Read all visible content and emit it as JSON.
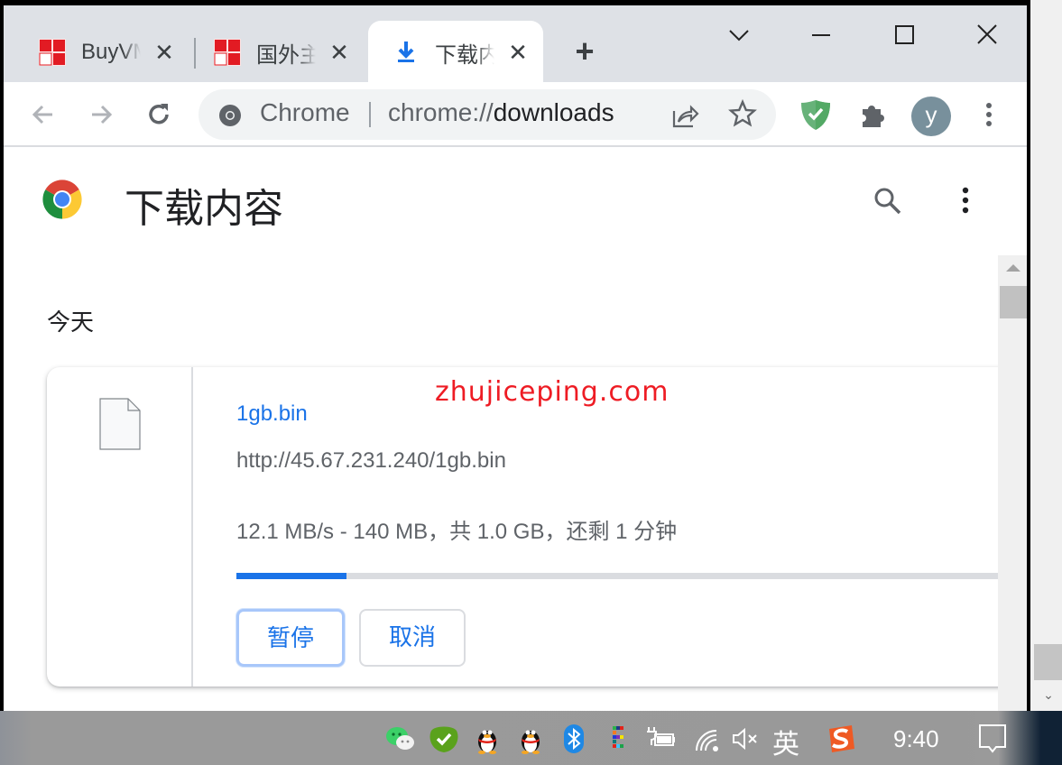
{
  "tabs": [
    {
      "label": "BuyVM",
      "favicon": "site-red-favicon",
      "close": "close-icon"
    },
    {
      "label": "国外主",
      "favicon": "site-red-favicon",
      "close": "close-icon"
    },
    {
      "label": "下载内容",
      "favicon": "download-icon",
      "close": "close-icon",
      "active": true
    }
  ],
  "window_controls": {
    "tab_search": "chevron-down-icon",
    "minimize": "minimize-icon",
    "maximize": "maximize-icon",
    "close": "close-icon"
  },
  "toolbar": {
    "omnibox_chip": "Chrome",
    "url_scheme": "chrome://",
    "url_host": "downloads",
    "avatar_letter": "y"
  },
  "page": {
    "title": "下载内容",
    "section": "今天",
    "watermark": "zhujiceping.com",
    "download": {
      "file_name": "1gb.bin",
      "url": "http://45.67.231.240/1gb.bin",
      "status": "12.1 MB/s - 140 MB，共 1.0 GB，还剩 1 分钟",
      "progress": 0.14,
      "pause_label": "暂停",
      "cancel_label": "取消"
    }
  },
  "taskbar": {
    "ime": "英",
    "clock": "9:40"
  },
  "colors": {
    "accent": "#1a73e8",
    "tabstrip": "#dee1e6",
    "watermark": "#ee1c24"
  }
}
